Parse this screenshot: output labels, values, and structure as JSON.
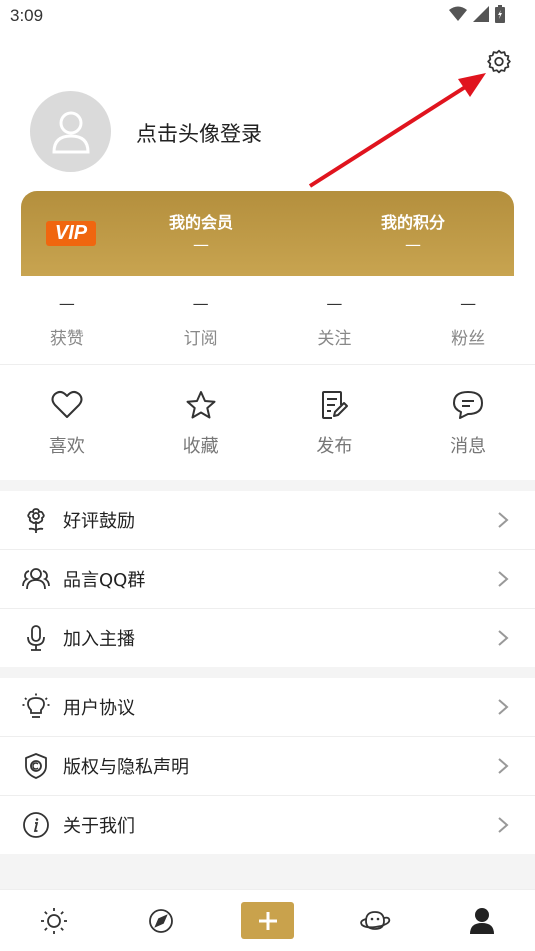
{
  "status_bar": {
    "time": "3:09"
  },
  "profile": {
    "login_prompt": "点击头像登录"
  },
  "vip": {
    "badge": "VIP",
    "member_label": "我的会员",
    "member_value": "—",
    "points_label": "我的积分",
    "points_value": "—"
  },
  "stats": [
    {
      "value": "—",
      "label": "获赞"
    },
    {
      "value": "—",
      "label": "订阅"
    },
    {
      "value": "—",
      "label": "关注"
    },
    {
      "value": "—",
      "label": "粉丝"
    }
  ],
  "actions": [
    {
      "label": "喜欢",
      "icon": "heart-icon"
    },
    {
      "label": "收藏",
      "icon": "star-icon"
    },
    {
      "label": "发布",
      "icon": "edit-icon"
    },
    {
      "label": "消息",
      "icon": "message-icon"
    }
  ],
  "menu_group1": [
    {
      "label": "好评鼓励",
      "icon": "flower-icon"
    },
    {
      "label": "品言QQ群",
      "icon": "group-icon"
    },
    {
      "label": "加入主播",
      "icon": "microphone-icon"
    }
  ],
  "menu_group2": [
    {
      "label": "用户协议",
      "icon": "lightbulb-icon"
    },
    {
      "label": "版权与隐私声明",
      "icon": "shield-copyright-icon"
    },
    {
      "label": "关于我们",
      "icon": "info-icon"
    }
  ],
  "bottom_nav": [
    {
      "icon": "sun-icon"
    },
    {
      "icon": "compass-icon"
    },
    {
      "icon": "plus-icon"
    },
    {
      "icon": "planet-icon"
    },
    {
      "icon": "user-icon"
    }
  ],
  "colors": {
    "gold": "#c9a24c",
    "vip_orange": "#f0660f",
    "arrow_red": "#e0141e"
  }
}
